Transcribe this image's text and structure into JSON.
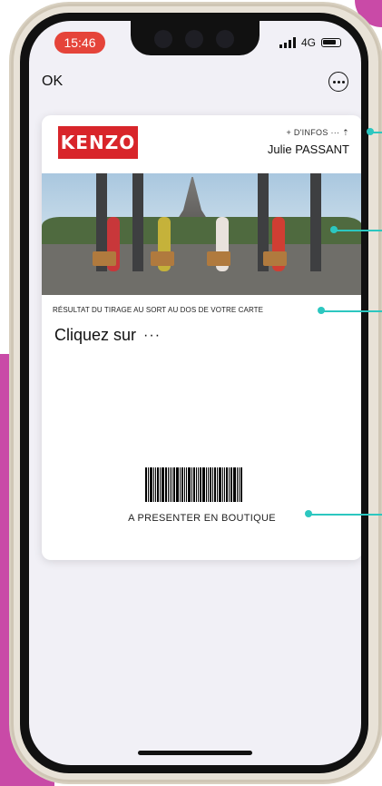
{
  "status_bar": {
    "time": "15:46",
    "network": "4G"
  },
  "nav": {
    "ok_label": "OK"
  },
  "card": {
    "brand": "KENZO",
    "info_link": "+ D'INFOS ··· ⇡",
    "holder_name": "Julie PASSANT",
    "draw_text": "RÉSULTAT DU TIRAGE AU SORT AU DOS DE VOTRE CARTE",
    "cta_text": "Cliquez sur",
    "cta_dots": "···",
    "barcode_label": "A PRESENTER EN BOUTIQUE"
  },
  "colors": {
    "brand_red": "#d8252a",
    "time_pill": "#e5443a",
    "accent_purple": "#c94aa7",
    "callout_teal": "#2cc7c0"
  },
  "icons": [
    "signal-icon",
    "battery-icon",
    "more-options-icon",
    "barcode-icon"
  ]
}
